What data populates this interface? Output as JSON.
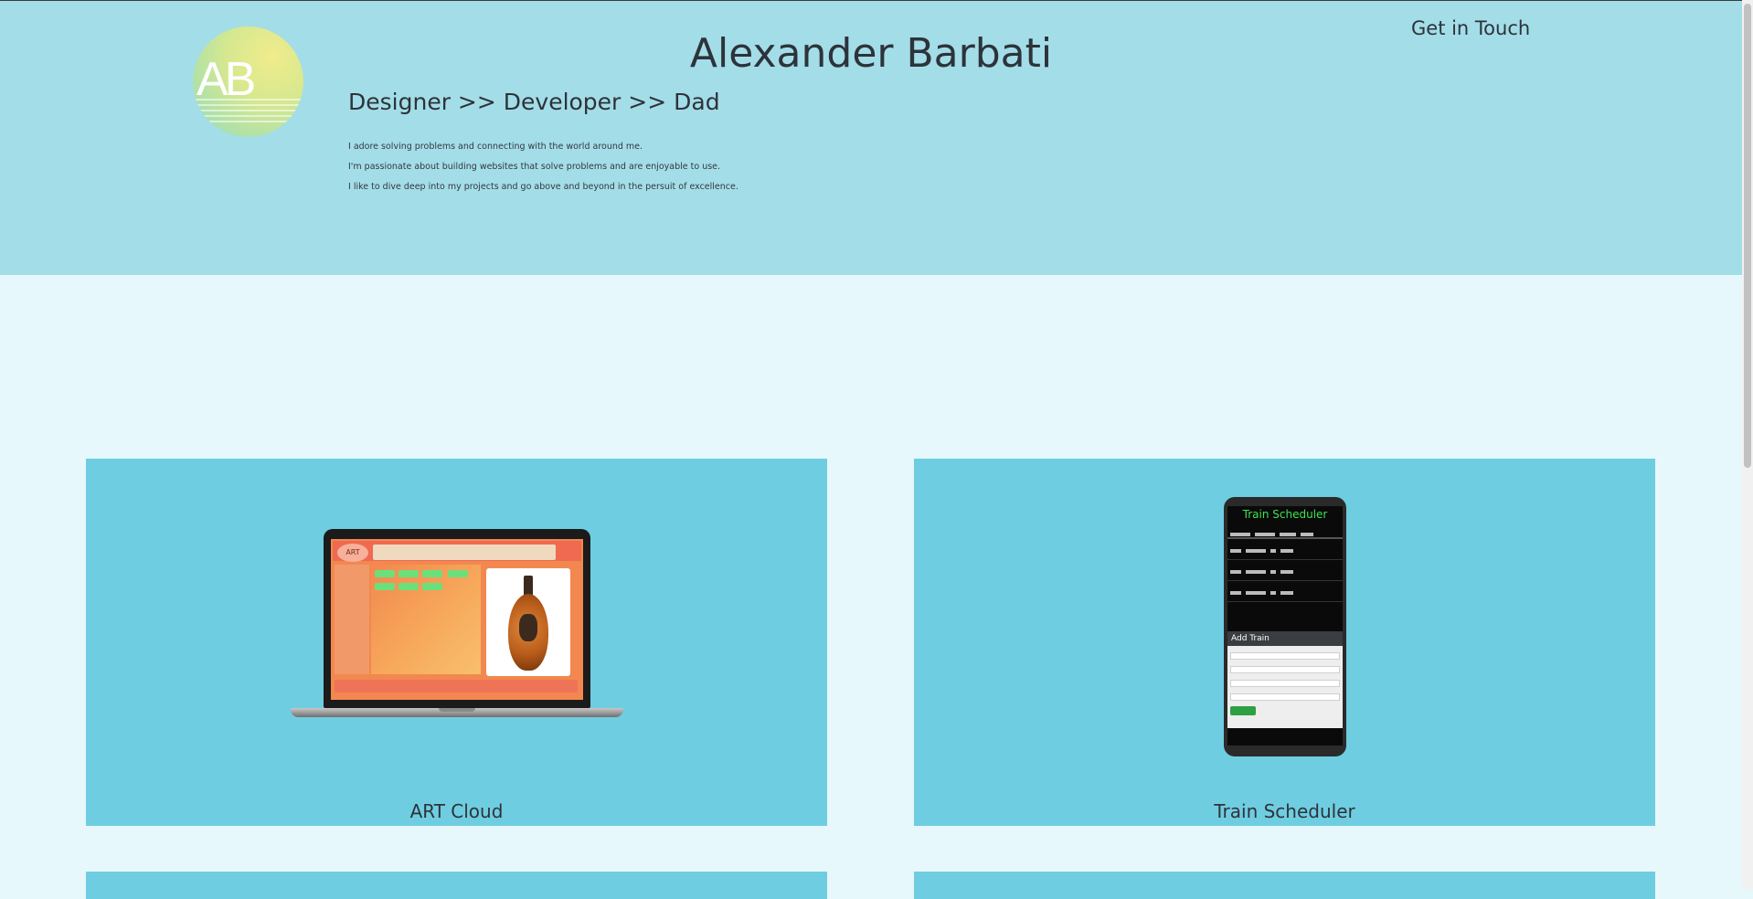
{
  "header": {
    "logo_text": "AB",
    "name": "Alexander Barbati",
    "contact_label": "Get in Touch",
    "tagline": "Designer >> Developer >> Dad",
    "bio": [
      "I adore solving problems and connecting with the world around me.",
      "I'm passionate about building websites that solve problems and are enjoyable to use.",
      "I like to dive deep into my projects and go above and beyond in the persuit of excellence."
    ]
  },
  "projects": [
    {
      "title": "ART Cloud",
      "mockup_text": "ART"
    },
    {
      "title": "Train Scheduler",
      "mockup_text": "Train Scheduler",
      "mockup_form_title": "Add Train"
    }
  ],
  "colors": {
    "page_background": "#e6f8fb",
    "header_background": "#a3dde8",
    "card_background": "#6fcde1",
    "text": "#2d333a"
  }
}
